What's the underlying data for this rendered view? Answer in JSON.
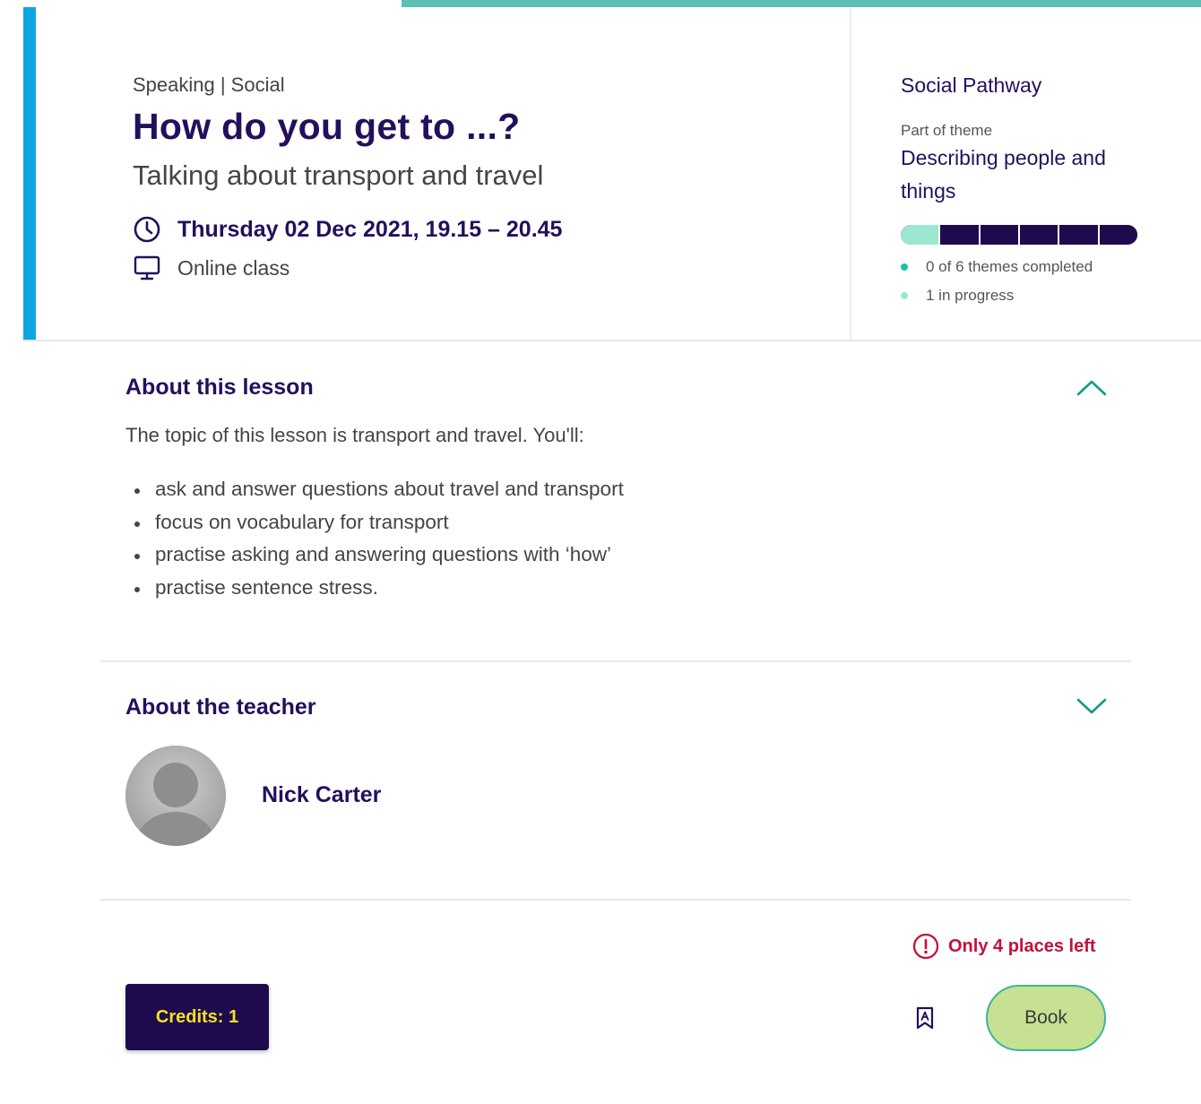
{
  "lesson": {
    "category": "Speaking | Social",
    "title": "How do you get to ...?",
    "subtitle": "Talking about transport and travel",
    "datetime": "Thursday 02 Dec 2021, 19.15 – 20.45",
    "mode": "Online class",
    "icons": {
      "datetime": "clock-icon",
      "mode": "monitor-icon"
    }
  },
  "pathway": {
    "name": "Social Pathway",
    "theme_label": "Part of theme",
    "theme_name": "Describing people and things",
    "progress": {
      "total_segments": 6,
      "in_progress_segments": 1,
      "completed_segments": 0
    },
    "legend": [
      {
        "text": "0 of 6 themes completed",
        "color": "#12c4a3"
      },
      {
        "text": "1 in progress",
        "color": "#9de6d1"
      }
    ]
  },
  "about_lesson": {
    "heading": "About this lesson",
    "expanded": true,
    "intro": "The topic of this lesson is transport and travel. You'll:",
    "bullets": [
      "ask and answer questions about travel and transport",
      "focus on vocabulary for transport",
      "practise asking and answering questions with ‘how’",
      "practise sentence stress."
    ]
  },
  "about_teacher": {
    "heading": "About the teacher",
    "expanded": false,
    "name": "Nick Carter",
    "avatar": "placeholder-avatar"
  },
  "footer": {
    "places_left": "Only 4 places left",
    "credits": "Credits: 1",
    "book_label": "Book",
    "bookmark_icon": "bookmark-icon"
  },
  "colors": {
    "brand_navy": "#23105c",
    "accent_blue": "#0ea5e4",
    "teal": "#5bbfb3",
    "alert_red": "#c4103a",
    "book_green": "#c5e191",
    "credits_yellow": "#f5e11e"
  }
}
